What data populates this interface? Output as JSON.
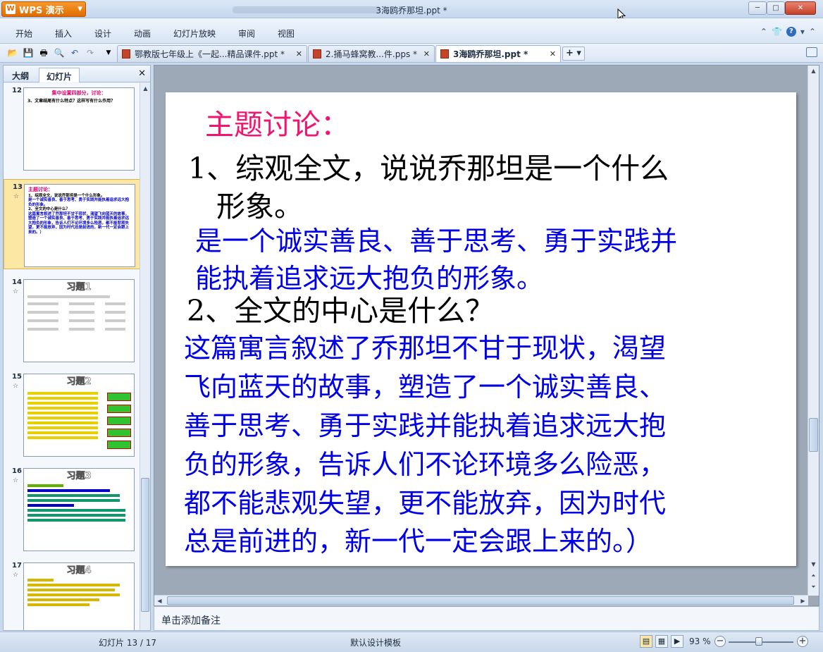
{
  "app": {
    "button_label": "WPS 演示",
    "logo_glyph": "W",
    "window_title": "3海鸥乔那坦.ppt *"
  },
  "menu": [
    "开始",
    "插入",
    "设计",
    "动画",
    "幻灯片放映",
    "审阅",
    "视图"
  ],
  "tabs": [
    {
      "label": "鄂教版七年级上《一起...精品课件.ppt *"
    },
    {
      "label": "2.捅马蜂窝教...件.pps *"
    },
    {
      "label": "3海鸥乔那坦.ppt *"
    }
  ],
  "left_panel": {
    "tab_outline": "大纲",
    "tab_slides": "幻灯片",
    "slides": [
      {
        "number": "12",
        "title": "集中设置四部分，讨论：",
        "lines": [
          "3、文章结尾有什么特点？这样写有什么作用？"
        ]
      },
      {
        "number": "13",
        "title": "主题讨论：",
        "lines": [
          "1、综观全文，说说乔那坦是一个什么形象。",
          "是一个诚实善良、善于思考、勇于实践并能执着追求远大抱负的形象。",
          "2、全文的中心是什么？",
          "这篇寓言叙述了乔那坦不甘于现状，渴望飞向蓝天的故事，塑造了一个诚实善良、善于思考、勇于实践并能执着追求远大抱负的形象，告诉人们不论环境多么险恶，都不能悲观失望，更不能放弃，因为时代总是前进的，新一代一定会跟上来的。）"
        ]
      },
      {
        "number": "14",
        "title": "习题1"
      },
      {
        "number": "15",
        "title": "习题2"
      },
      {
        "number": "16",
        "title": "习题3"
      },
      {
        "number": "17",
        "title": "习题4"
      }
    ]
  },
  "slide": {
    "title": "主题讨论：",
    "q1_line1": "1、综观全文，说说乔那坦是一个什么",
    "q1_line2": "形象。",
    "a1_line1": "是一个诚实善良、善于思考、勇于实践并",
    "a1_line2": "能执着追求远大抱负的形象。",
    "q2": "2、全文的中心是什么？",
    "a2_lines": [
      "这篇寓言叙述了乔那坦不甘于现状，渴望",
      "飞向蓝天的故事，塑造了一个诚实善良、",
      "善于思考、勇于实践并能执着追求远大抱",
      "负的形象，告诉人们不论环境多么险恶，",
      "都不能悲观失望，更不能放弃，因为时代",
      "总是前进的，新一代一定会跟上来的。）"
    ]
  },
  "notes_placeholder": "单击添加备注",
  "status": {
    "slide_counter": "幻灯片 13 / 17",
    "template": "默认设计模板",
    "zoom": "93 %"
  },
  "colors": {
    "title_pink": "#f0166f",
    "answer_blue": "#0000e8",
    "selected_slide": "#fce7a4"
  }
}
